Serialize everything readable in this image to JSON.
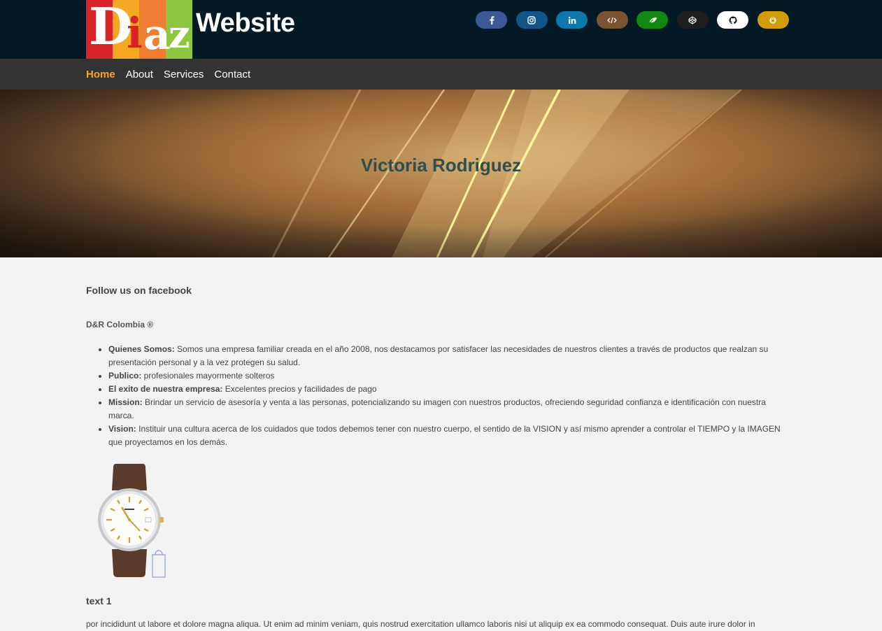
{
  "header": {
    "logo_letters": [
      "D",
      "i",
      "a",
      "z"
    ],
    "site_title": "Website",
    "socials": [
      {
        "icon": "facebook-icon",
        "color": "#3b5998"
      },
      {
        "icon": "instagram-icon",
        "color": "#125688"
      },
      {
        "icon": "linkedin-icon",
        "color": "#0e76a8"
      },
      {
        "icon": "code-icon",
        "color": "#7b5232"
      },
      {
        "icon": "leaf-icon",
        "color": "#118811"
      },
      {
        "icon": "codepen-icon",
        "color": "#1e1e1e"
      },
      {
        "icon": "github-icon",
        "color": "#ffffff"
      },
      {
        "icon": "gitlab-icon",
        "color": "#d19b09"
      }
    ]
  },
  "nav": {
    "items": [
      "Home",
      "About",
      "Services",
      "Contact"
    ],
    "active": "Home",
    "active_color": "#f5a623"
  },
  "hero": {
    "title": "Victoria Rodriguez"
  },
  "content": {
    "follow_heading": "Follow us on facebook",
    "brand": "D&R Colombia ®",
    "items": [
      {
        "label": "Quienes Somos:",
        "text": " Somos una empresa familiar creada en el año 2008, nos destacamos por satisfacer las necesidades de nuestros clientes a través de productos que realzan su presentación personal y a la vez protegen su salud."
      },
      {
        "label": "Publico:",
        "text": " profesionales mayormente solteros"
      },
      {
        "label": "El exito de nuestra empresa:",
        "text": " Excelentes precios y facilidades de pago"
      },
      {
        "label": "Mission:",
        "text": " Brindar un servicio de asesoría y venta a las personas, potencializando su imagen con nuestros productos, ofreciendo seguridad confianza e identificación con nuestra marca."
      },
      {
        "label": "Vision:",
        "text": " Instituir una cultura acerca de los cuidados que todos debemos tener con nuestro cuerpo, el sentido de la VISION y así mismo aprender a controlar el TIEMPO y la IMAGEN que proyectamos en los demás."
      }
    ],
    "image_icon": "wristwatch-image",
    "text1_heading": "text 1",
    "text1_body": "por incididunt ut labore et dolore magna aliqua. Ut enim ad minim veniam, quis nostrud exercitation ullamco laboris nisi ut aliquip ex ea commodo consequat. Duis aute irure dolor in"
  }
}
